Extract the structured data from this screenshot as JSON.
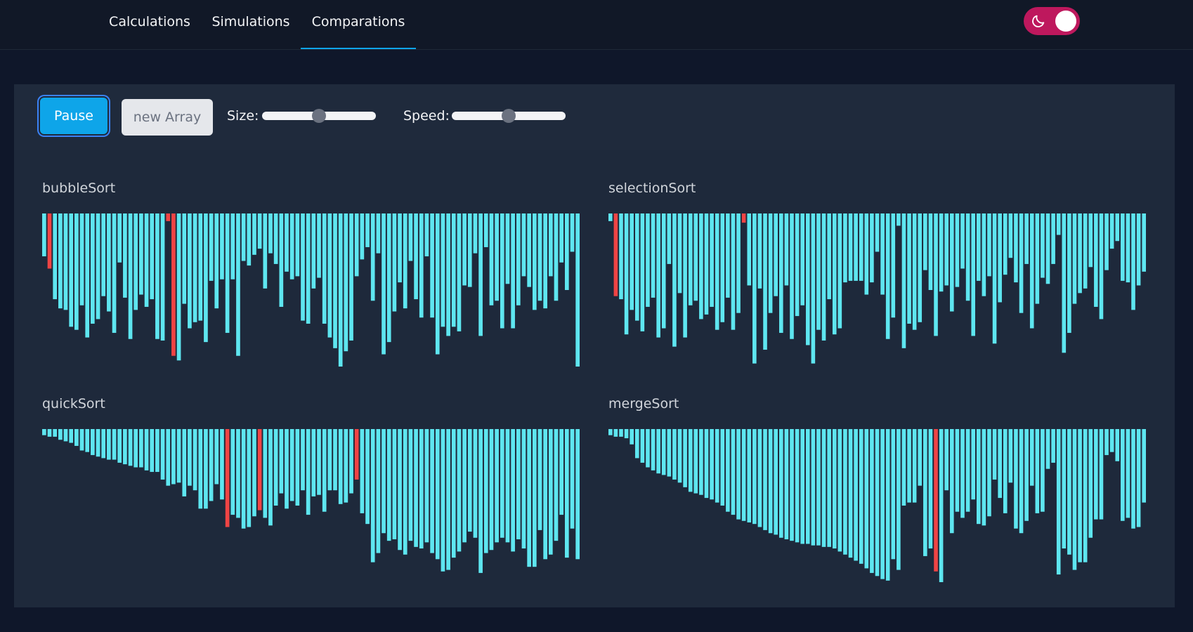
{
  "nav": {
    "tabs": [
      {
        "label": "Calculations",
        "active": false
      },
      {
        "label": "Simulations",
        "active": false
      },
      {
        "label": "Comparations",
        "active": true
      }
    ],
    "theme_toggle": {
      "icon": "moon-icon",
      "state": "dark"
    }
  },
  "controls": {
    "pause_label": "Pause",
    "new_array_label": "new Array",
    "size_label": "Size:",
    "speed_label": "Speed:",
    "size_value": 0.5,
    "speed_value": 0.5
  },
  "colors": {
    "bar": "#5ee6f0",
    "active_bar": "#ef4444",
    "accent": "#0ea5e9",
    "toggle": "#be185d"
  },
  "chart_data": [
    {
      "type": "bar",
      "title": "bubbleSort",
      "ylim": [
        0,
        100
      ],
      "values": [
        28,
        36,
        56,
        62,
        63,
        74,
        76,
        60,
        81,
        72,
        69,
        54,
        64,
        78,
        32,
        55,
        82,
        63,
        53,
        61,
        56,
        82,
        83,
        5,
        93,
        96,
        59,
        75,
        71,
        70,
        84,
        44,
        62,
        43,
        78,
        43,
        93,
        31,
        34,
        27,
        23,
        49,
        26,
        33,
        61,
        38,
        43,
        41,
        70,
        72,
        49,
        42,
        72,
        81,
        88,
        100,
        90,
        83,
        41,
        30,
        22,
        57,
        26,
        92,
        84,
        64,
        45,
        62,
        31,
        56,
        68,
        28,
        68,
        92,
        74,
        80,
        74,
        77,
        47,
        48,
        26,
        80,
        22,
        60,
        57,
        75,
        46,
        75,
        60,
        41,
        48,
        63,
        57,
        62,
        41,
        57,
        32,
        50,
        25,
        100
      ],
      "highlight": [
        1,
        23,
        24
      ]
    },
    {
      "type": "bar",
      "title": "selectionSort",
      "ylim": [
        0,
        100
      ],
      "values": [
        5,
        54,
        56,
        79,
        63,
        70,
        77,
        61,
        55,
        81,
        75,
        33,
        87,
        52,
        81,
        60,
        57,
        69,
        66,
        61,
        76,
        71,
        55,
        76,
        65,
        6,
        47,
        98,
        49,
        89,
        65,
        54,
        78,
        47,
        82,
        67,
        60,
        86,
        98,
        76,
        83,
        56,
        79,
        75,
        45,
        44,
        44,
        44,
        53,
        45,
        25,
        53,
        82,
        68,
        8,
        88,
        72,
        76,
        71,
        37,
        50,
        80,
        51,
        47,
        64,
        48,
        36,
        57,
        80,
        44,
        54,
        41,
        85,
        58,
        40,
        29,
        45,
        65,
        33,
        75,
        59,
        42,
        46,
        33,
        14,
        91,
        78,
        59,
        52,
        49,
        35,
        61,
        69,
        37,
        23,
        18,
        44,
        45,
        63,
        47,
        38
      ],
      "highlight": [
        1,
        25
      ]
    },
    {
      "type": "bar",
      "title": "quickSort",
      "ylim": [
        0,
        100
      ],
      "values": [
        4,
        5,
        5,
        7,
        8,
        9,
        11,
        14,
        15,
        17,
        18,
        19,
        20,
        20,
        22,
        23,
        24,
        25,
        25,
        27,
        28,
        28,
        33,
        37,
        36,
        35,
        44,
        37,
        40,
        52,
        52,
        47,
        36,
        46,
        64,
        56,
        58,
        65,
        64,
        57,
        53,
        58,
        63,
        50,
        42,
        52,
        47,
        50,
        40,
        56,
        44,
        43,
        54,
        40,
        40,
        49,
        48,
        42,
        33,
        55,
        62,
        87,
        81,
        68,
        73,
        72,
        79,
        82,
        73,
        77,
        78,
        74,
        81,
        85,
        93,
        92,
        84,
        80,
        74,
        67,
        71,
        94,
        81,
        79,
        74,
        71,
        74,
        80,
        72,
        78,
        90,
        90,
        66,
        85,
        82,
        73,
        56,
        84,
        65,
        85
      ],
      "highlight": [
        34,
        40,
        58
      ]
    },
    {
      "type": "bar",
      "title": "mergeSort",
      "ylim": [
        0,
        100
      ],
      "values": [
        4,
        5,
        5,
        6,
        10,
        19,
        22,
        25,
        27,
        29,
        30,
        31,
        33,
        35,
        38,
        41,
        42,
        43,
        45,
        46,
        48,
        50,
        54,
        56,
        59,
        60,
        61,
        62,
        64,
        66,
        68,
        69,
        71,
        72,
        73,
        74,
        75,
        75,
        76,
        76,
        77,
        77,
        78,
        80,
        82,
        84,
        86,
        88,
        91,
        94,
        96,
        98,
        99,
        85,
        92,
        50,
        48,
        48,
        37,
        83,
        78,
        93,
        100,
        40,
        68,
        54,
        58,
        54,
        46,
        62,
        63,
        57,
        33,
        45,
        55,
        35,
        65,
        68,
        60,
        37,
        55,
        54,
        26,
        22,
        95,
        78,
        82,
        92,
        87,
        87,
        71,
        59,
        59,
        17,
        15,
        21,
        60,
        58,
        65,
        64,
        48
      ],
      "highlight": [
        61
      ]
    }
  ]
}
